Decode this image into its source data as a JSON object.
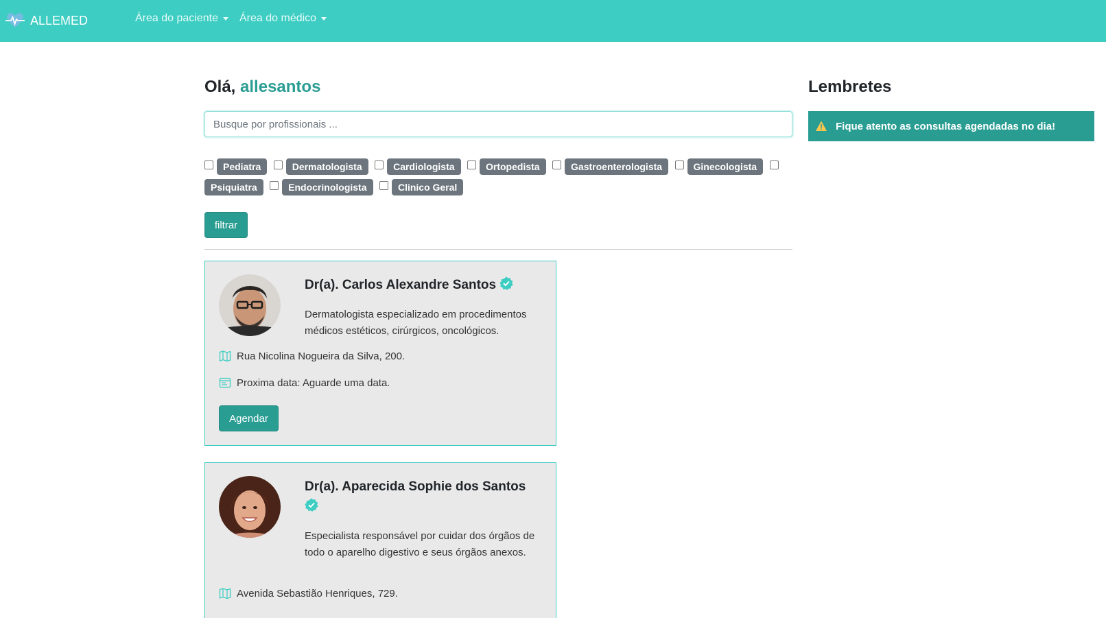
{
  "navbar": {
    "brand": "ALLEMED",
    "menu": [
      {
        "label": "Área do paciente"
      },
      {
        "label": "Área do médico"
      }
    ]
  },
  "main": {
    "greeting_prefix": "Olá, ",
    "username": "allesantos",
    "search_placeholder": "Busque por profissionais ...",
    "specialties": [
      "Pediatra",
      "Dermatologista",
      "Cardiologista",
      "Ortopedista",
      "Gastroenterologista",
      "Ginecologista",
      "Psiquiatra",
      "Endocrinologista",
      "Clinico Geral"
    ],
    "filter_button": "filtrar",
    "doctors": [
      {
        "name": "Dr(a). Carlos Alexandre Santos",
        "description": "Dermatologista especializado em procedimentos médicos estéticos, cirúrgicos, oncológicos.",
        "address": "Rua Nicolina Nogueira da Silva, 200.",
        "next_date": "Proxima data: Aguarde uma data.",
        "button": "Agendar"
      },
      {
        "name": "Dr(a). Aparecida Sophie dos Santos",
        "description": "Especialista responsável por cuidar dos órgãos de todo o aparelho digestivo e seus órgãos anexos.",
        "address": "Avenida Sebastião Henriques, 729."
      }
    ]
  },
  "reminders": {
    "title": "Lembretes",
    "alert": "Fique atento as consultas agendadas no dia!"
  },
  "colors": {
    "navbar": "#3ecdc2",
    "accent": "#2a9d93",
    "badge": "#6c757d",
    "card_bg": "#e9e9e9"
  },
  "icons": {
    "brand": "heart-pulse-icon",
    "verified": "verified-badge-icon",
    "address": "map-icon",
    "date": "calendar-icon",
    "alert": "warning-triangle-icon"
  }
}
